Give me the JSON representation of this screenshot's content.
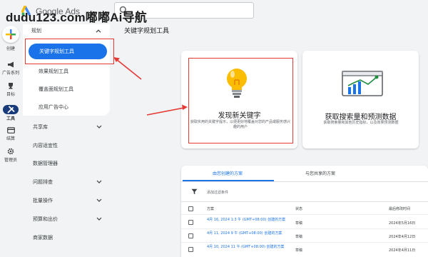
{
  "app": {
    "logo_text": "Google Ads",
    "watermark": "dudu123.com嘟嘟Ai导航"
  },
  "rail": {
    "items": [
      {
        "label": "创建",
        "icon": "plus-icon"
      },
      {
        "label": "广告系列",
        "icon": "megaphone-icon"
      },
      {
        "label": "目标",
        "icon": "trophy-icon"
      },
      {
        "label": "工具",
        "icon": "tools-icon"
      },
      {
        "label": "结算",
        "icon": "card-icon"
      },
      {
        "label": "管理员",
        "icon": "gear-icon"
      }
    ]
  },
  "sidebar": {
    "section": "规划",
    "items": [
      "关键字规划工具",
      "效果规划工具",
      "覆盖面规划工具",
      "应用广告中心"
    ],
    "groups": [
      "共享库",
      "内容适宜性",
      "数据管理器",
      "问题排查",
      "批量操作",
      "预算和出价",
      "商家数据"
    ]
  },
  "page": {
    "title": "关键字规划工具"
  },
  "cards": {
    "discover": {
      "title": "发现新关键字",
      "desc": "获取实用的关键字提示，以便更好地覆盖对您的产品或服务感兴趣的用户"
    },
    "forecast": {
      "title": "获取搜索量和预测数据",
      "desc": "获取搜索量和其他历史指标，以及效果预测数据"
    }
  },
  "plans": {
    "tabs": [
      "由您创建的方案",
      "与您共享的方案"
    ],
    "filter_label": "添加过滤条件",
    "columns": [
      "方案",
      "状态",
      "最后修改时间"
    ],
    "rows": [
      {
        "name": "4月 16, 2024 1:3 午 (GMT+08:00) 创建的方案",
        "status": "草稿",
        "date": "2024年5月16日"
      },
      {
        "name": "4月 11, 2024 9 午 (GMT+08:00) 创建的方案",
        "status": "草稿",
        "date": "2024年4月12日"
      },
      {
        "name": "4月 10, 2024 11 午 (GMT+08:00) 创建的方案",
        "status": "草稿",
        "date": "2024年4月11日"
      }
    ]
  },
  "colors": {
    "accent": "#1a73e8",
    "annotation": "#e53935",
    "tools_active": "#1a3b7a"
  }
}
